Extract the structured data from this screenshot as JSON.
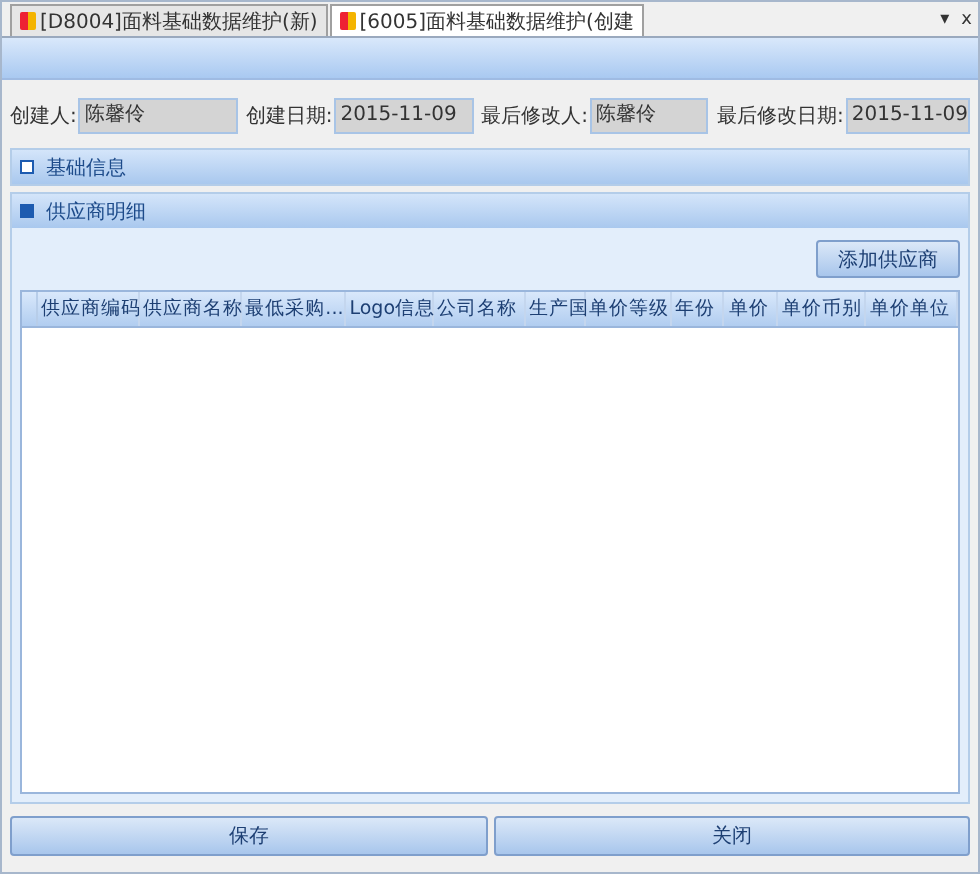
{
  "tabs": [
    {
      "label": "[D8004]面料基础数据维护(新)",
      "selected": false
    },
    {
      "label": "[6005]面料基础数据维护(创建",
      "selected": true
    }
  ],
  "tab_menu": "▾",
  "tab_close": "x",
  "fields": [
    {
      "label": "创建人:",
      "value": "陈馨伶"
    },
    {
      "label": "创建日期:",
      "value": "2015-11-09"
    },
    {
      "label": "最后修改人:",
      "value": "陈馨伶"
    },
    {
      "label": "最后修改日期:",
      "value": "2015-11-09"
    }
  ],
  "sections": [
    {
      "title": "基础信息",
      "expanded": false
    },
    {
      "title": "供应商明细",
      "expanded": true
    }
  ],
  "add_button": "添加供应商",
  "table": {
    "columns": [
      "供应商编码",
      "供应商名称",
      "最低采购...",
      "Logo信息",
      "公司名称",
      "生产国",
      "单价等级",
      "年份",
      "单价",
      "单价币别",
      "单价单位"
    ]
  },
  "buttons": [
    "保存",
    "关闭"
  ]
}
